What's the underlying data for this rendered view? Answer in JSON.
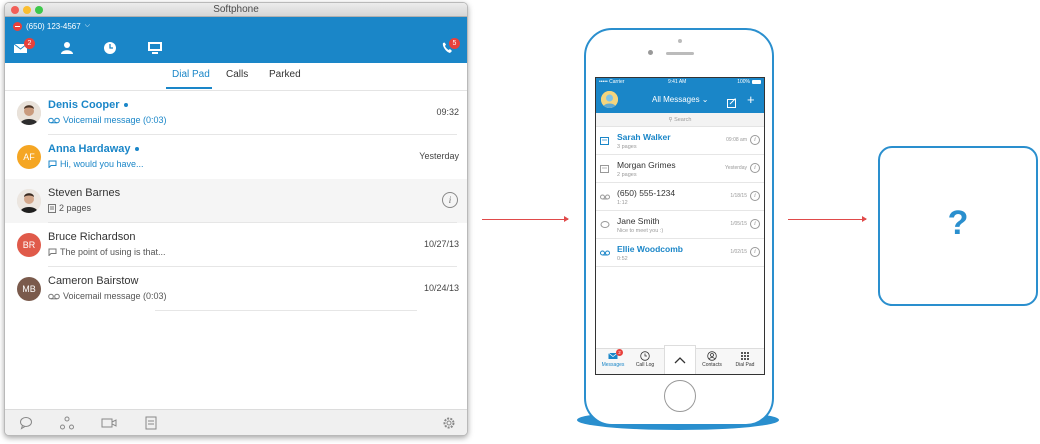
{
  "window": {
    "title": "Softphone"
  },
  "status": {
    "number": "(650) 123-4567"
  },
  "toolbar": {
    "messages_badge": "2",
    "calls_badge": "5"
  },
  "tabs": [
    {
      "label": "Dial Pad",
      "active": true
    },
    {
      "label": "Calls",
      "active": false
    },
    {
      "label": "Parked",
      "active": false
    }
  ],
  "conversations": [
    {
      "name": "Denis Cooper",
      "detail": "Voicemail message (0:03)",
      "time": "09:32",
      "initials": "",
      "unread": true,
      "kind": "voicemail"
    },
    {
      "name": "Anna Hardaway",
      "detail": "Hi, would you have...",
      "time": "Yesterday",
      "initials": "AF",
      "unread": true,
      "kind": "text"
    },
    {
      "name": "Steven Barnes",
      "detail": "2 pages",
      "time": "",
      "initials": "",
      "unread": false,
      "kind": "fax"
    },
    {
      "name": "Bruce Richardson",
      "detail": "The point of using is that...",
      "time": "10/27/13",
      "initials": "BR",
      "unread": false,
      "kind": "text"
    },
    {
      "name": "Cameron Bairstow",
      "detail": "Voicemail message (0:03)",
      "time": "10/24/13",
      "initials": "MB",
      "unread": false,
      "kind": "voicemail"
    }
  ],
  "phone": {
    "status_left": "••••• Carrier",
    "status_time": "9:41 AM",
    "status_battery": "100%",
    "nav_title": "All Messages",
    "search_placeholder": "Search",
    "messages": [
      {
        "name": "Sarah Walker",
        "sub": "3 pages",
        "time": "09:08 am",
        "unread": true
      },
      {
        "name": "Morgan Grimes",
        "sub": "2 pages",
        "time": "Yesterday",
        "unread": false
      },
      {
        "name": "(650) 555-1234",
        "sub": "1:12",
        "time": "1/18/15",
        "unread": false
      },
      {
        "name": "Jane Smith",
        "sub": "Nice to meet you :)",
        "time": "1/05/15",
        "unread": false
      },
      {
        "name": "Ellie Woodcomb",
        "sub": "0:52",
        "time": "1/02/15",
        "unread": true
      }
    ],
    "tabbar": [
      {
        "label": "Messages",
        "active": true
      },
      {
        "label": "Call Log",
        "active": false
      },
      {
        "label": "Contacts",
        "active": false
      },
      {
        "label": "Dial Pad",
        "active": false
      }
    ],
    "messages_badge": "2"
  },
  "unknown_box": {
    "symbol": "?"
  },
  "colors": {
    "accent": "#1a86c8",
    "badge": "#e8403b",
    "arrow": "#e04a4a"
  }
}
